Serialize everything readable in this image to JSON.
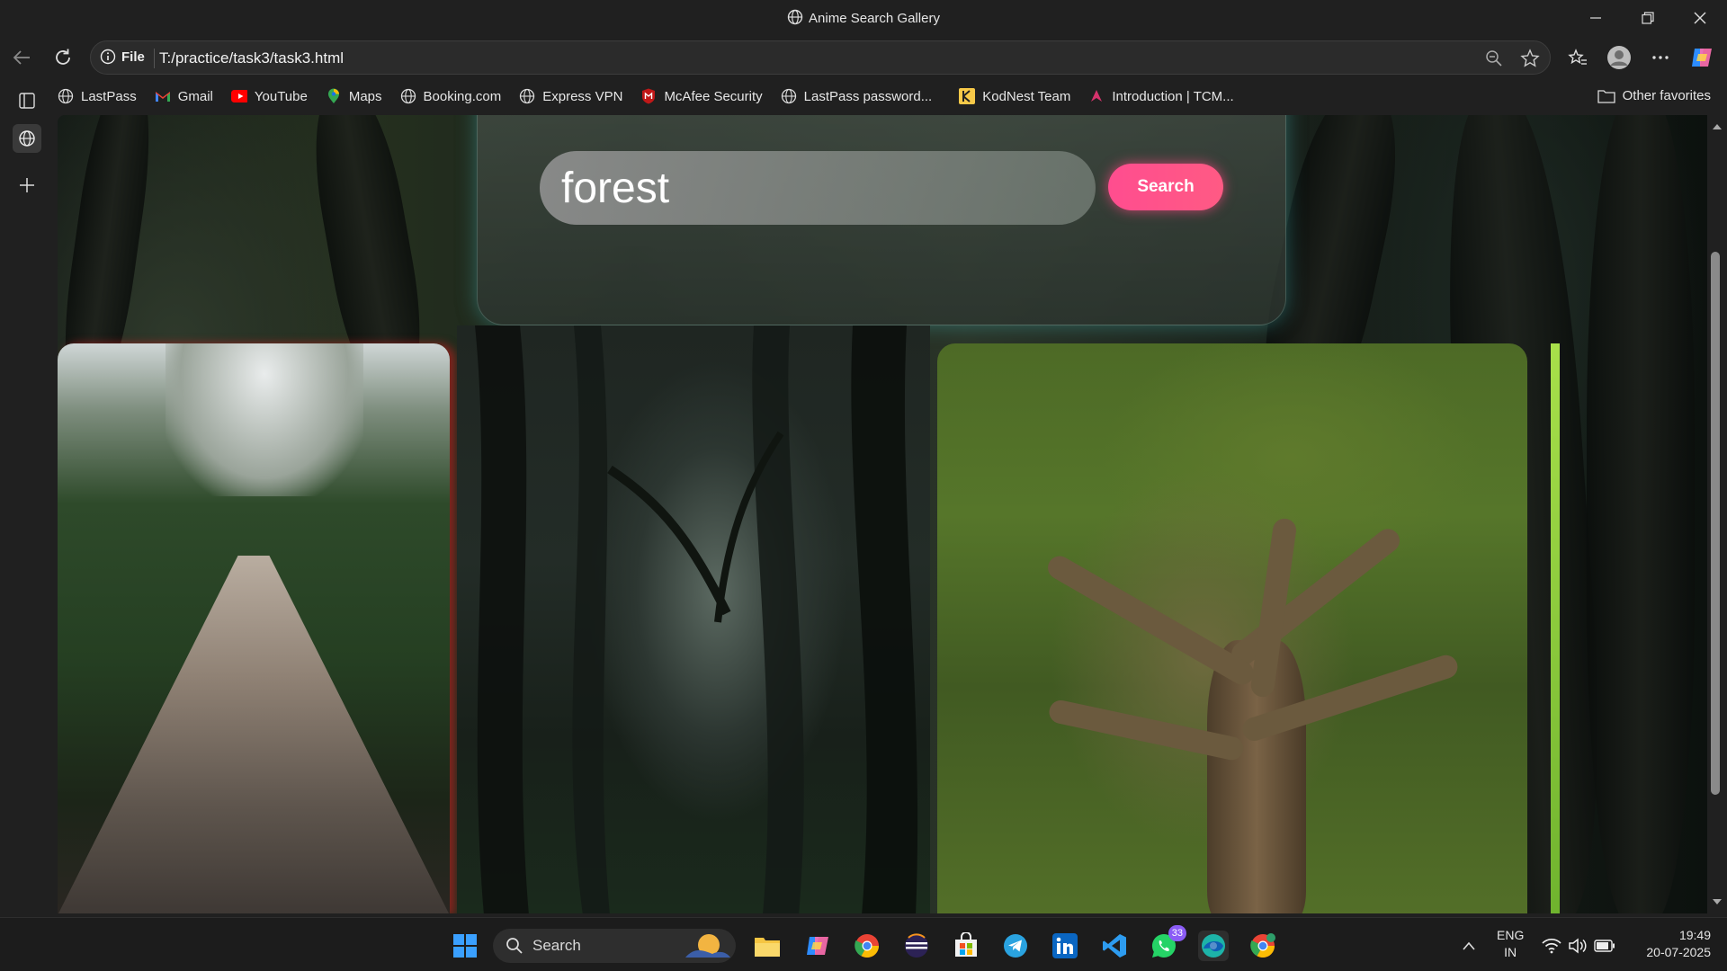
{
  "window": {
    "title": "Anime Search Gallery"
  },
  "addressbar": {
    "scheme_label": "File",
    "url": "T:/practice/task3/task3.html"
  },
  "favorites": {
    "items": [
      {
        "label": "LastPass",
        "icon": "globe-icon"
      },
      {
        "label": "Gmail",
        "icon": "gmail-icon"
      },
      {
        "label": "YouTube",
        "icon": "youtube-icon"
      },
      {
        "label": "Maps",
        "icon": "maps-pin-icon"
      },
      {
        "label": "Booking.com",
        "icon": "globe-icon"
      },
      {
        "label": "Express VPN",
        "icon": "globe-icon"
      },
      {
        "label": "McAfee Security",
        "icon": "mcafee-icon"
      },
      {
        "label": "LastPass password...",
        "icon": "globe-icon"
      },
      {
        "label": "KodNest Team",
        "icon": "kodnest-icon"
      },
      {
        "label": "Introduction | TCM...",
        "icon": "tcm-icon"
      }
    ],
    "other_label": "Other favorites"
  },
  "page": {
    "search_value": "forest",
    "search_button": "Search",
    "accent_color": "#ff4d8f",
    "panel_glow_color": "#3c9696"
  },
  "taskbar": {
    "search_label": "Search",
    "whatsapp_badge": "33",
    "lang_line1": "ENG",
    "lang_line2": "IN",
    "time": "19:49",
    "date": "20-07-2025"
  }
}
